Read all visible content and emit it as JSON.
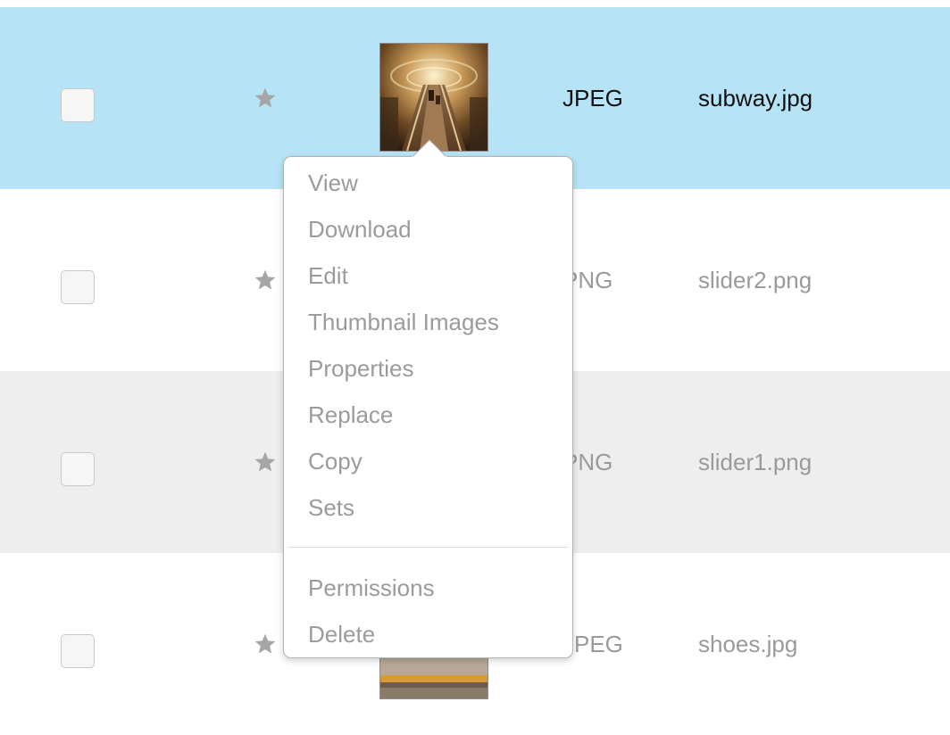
{
  "rows": [
    {
      "type": "JPEG",
      "name": "subway.jpg"
    },
    {
      "type": "PNG",
      "name": "slider2.png"
    },
    {
      "type": "PNG",
      "name": "slider1.png"
    },
    {
      "type": "JPEG",
      "name": "shoes.jpg"
    }
  ],
  "context_menu": {
    "items": [
      "View",
      "Download",
      "Edit",
      "Thumbnail Images",
      "Properties",
      "Replace",
      "Copy",
      "Sets"
    ],
    "secondary_items": [
      "Permissions",
      "Delete"
    ]
  },
  "colors": {
    "selected_row": "#b7e3f6",
    "alt_row": "#eeeeee",
    "menu_text": "#9b9b9b",
    "star": "#a6a6a6"
  },
  "icons": {
    "favorite": "star-icon",
    "checkbox": "checkbox"
  }
}
